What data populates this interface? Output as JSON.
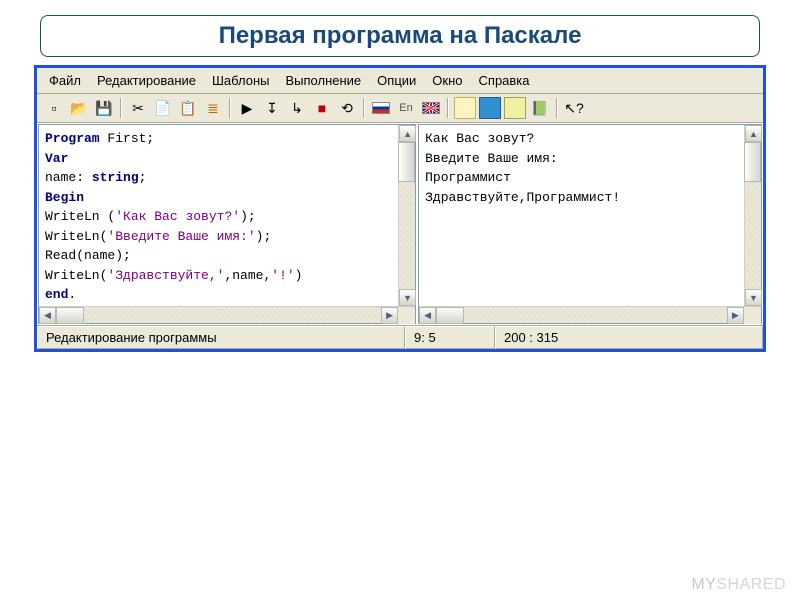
{
  "title": "Первая программа на Паскале",
  "menu": {
    "file": "Файл",
    "edit": "Редактирование",
    "templates": "Шаблоны",
    "run": "Выполнение",
    "options": "Опции",
    "window": "Окно",
    "help": "Справка"
  },
  "toolbar": {
    "en_label": "En"
  },
  "code": {
    "l1_kw": "Program ",
    "l1_txt": "First;",
    "l2_kw": "Var",
    "l3_txt": "name: ",
    "l3_kw": "string",
    "l3_tail": ";",
    "l4_kw": "Begin",
    "l5_fn": "WriteLn ",
    "l5_paren_open": "(",
    "l5_str": "'Как Вас зовут?'",
    "l5_paren_close": ");",
    "l6_fn": "WriteLn",
    "l6_paren_open": "(",
    "l6_str": "'Введите Ваше имя:'",
    "l6_paren_close": ");",
    "l7_fn": "Read",
    "l7_txt": "(name);",
    "l8_fn": "WriteLn",
    "l8_paren_open": "(",
    "l8_str1": "'Здравствуйте,'",
    "l8_mid": ",name,",
    "l8_str2": "'!'",
    "l8_paren_close": ")",
    "l9_kw": "end",
    "l9_txt": "."
  },
  "output": {
    "l1": "Как Вас зовут?",
    "l2": "Введите Ваше имя:",
    "l3": "Программист",
    "l4": "Здравствуйте,Программист!"
  },
  "status": {
    "mode": "Редактирование программы",
    "pos": "9: 5",
    "extra": "200 : 315"
  },
  "watermark": {
    "left": "MY",
    "right": "SHARED"
  }
}
